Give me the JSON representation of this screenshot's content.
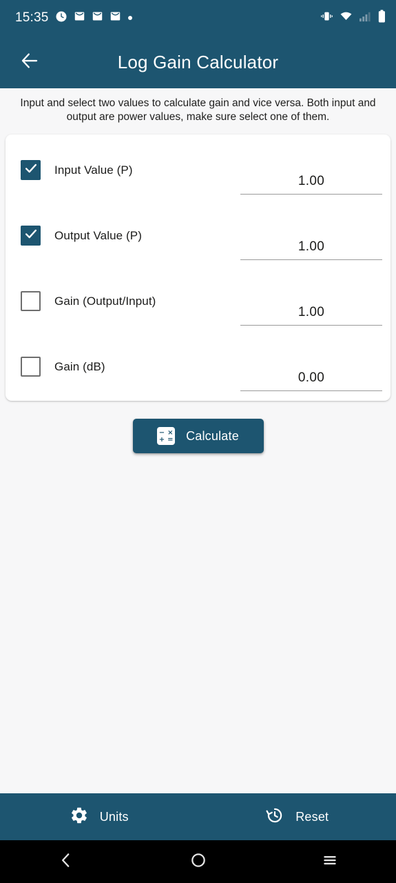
{
  "statusbar": {
    "clock": "15:35",
    "left_icons": [
      {
        "name": "alarm-clock-icon"
      },
      {
        "name": "mail-icon"
      },
      {
        "name": "mail-icon"
      },
      {
        "name": "mail-icon"
      },
      {
        "name": "dot-indicator-icon"
      }
    ],
    "right_icons": [
      {
        "name": "vibrate-icon"
      },
      {
        "name": "wifi-no-internet-icon"
      },
      {
        "name": "cellular-signal-icon"
      },
      {
        "name": "battery-full-icon"
      }
    ]
  },
  "appbar": {
    "back_label": "Back",
    "title": "Log Gain Calculator"
  },
  "description": "Input and select two values to calculate gain and vice versa. Both input and output are power values, make sure select one of them.",
  "rows": [
    {
      "label": "Input Value (P)",
      "checked": true,
      "value": "1.00",
      "name": "input-value-p"
    },
    {
      "label": "Output Value (P)",
      "checked": true,
      "value": "1.00",
      "name": "output-value-p"
    },
    {
      "label": "Gain (Output/Input)",
      "checked": false,
      "value": "1.00",
      "name": "gain-ratio"
    },
    {
      "label": "Gain (dB)",
      "checked": false,
      "value": "0.00",
      "name": "gain-db"
    }
  ],
  "calculate": {
    "label": "Calculate",
    "icon": "calculator-icon",
    "icon_symbols_top": [
      "−",
      "×"
    ],
    "icon_symbols_bottom": [
      "+",
      "="
    ]
  },
  "bottombar": {
    "items": [
      {
        "label": "Units",
        "icon": "gear-icon",
        "name": "units"
      },
      {
        "label": "Reset",
        "icon": "history-restore-icon",
        "name": "reset"
      }
    ]
  },
  "navbar": {
    "items": [
      {
        "name": "android-back-button",
        "icon": "chevron-left-icon"
      },
      {
        "name": "android-home-button",
        "icon": "circle-icon"
      },
      {
        "name": "android-recents-button",
        "icon": "hamburger-icon"
      }
    ]
  },
  "colors": {
    "primary": "#1d5570",
    "background": "#f7f7f8",
    "card": "#ffffff",
    "navbar": "#000000",
    "text": "#1c1c1b",
    "underline": "#9a9a9a",
    "checkbox_border": "#6e6e6e"
  }
}
